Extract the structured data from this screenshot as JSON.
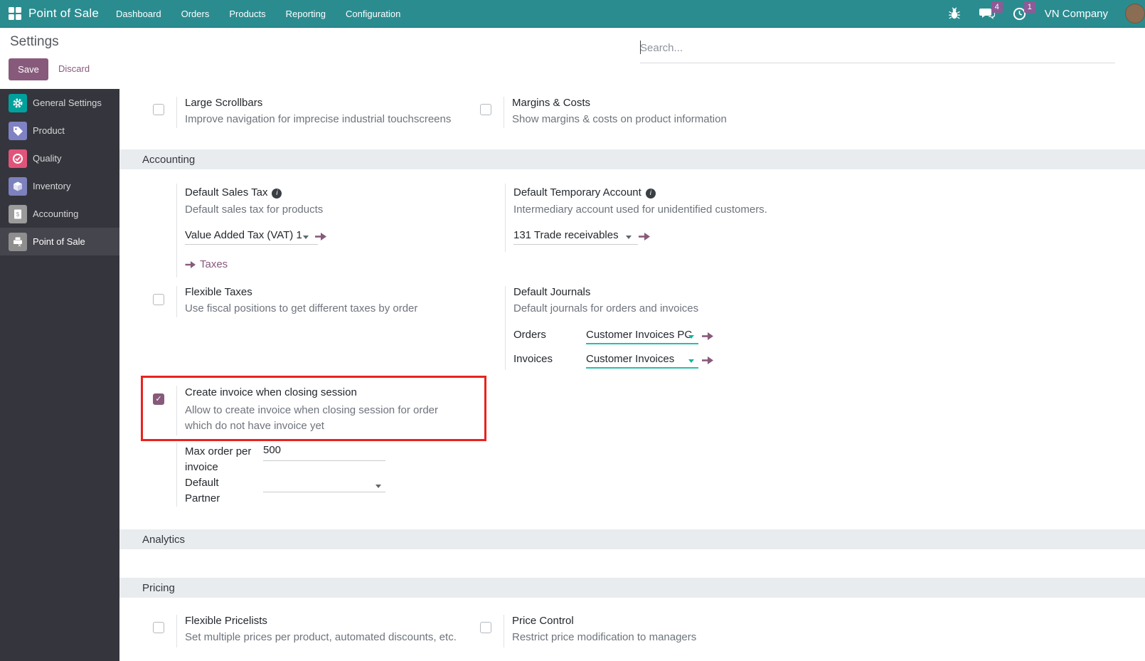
{
  "icons": {
    "check": "✓",
    "info": "i"
  },
  "colors": {
    "navbar": "#2b8c90",
    "accent": "#875A7B",
    "badge": "#8d5b97",
    "teal_underline": "#25bfae",
    "highlight_red": "#e8231d",
    "section_header_bg": "#e9ecef",
    "sidebar_bg": "#35353d"
  },
  "navbar": {
    "app_title": "Point of Sale",
    "menu": [
      {
        "label": "Dashboard"
      },
      {
        "label": "Orders"
      },
      {
        "label": "Products"
      },
      {
        "label": "Reporting"
      },
      {
        "label": "Configuration"
      }
    ],
    "message_count": "4",
    "activity_count": "1",
    "company": "VN Company"
  },
  "control_panel": {
    "title": "Settings",
    "save": "Save",
    "discard": "Discard",
    "search_placeholder": "Search..."
  },
  "sidebar": {
    "items": [
      {
        "label": "General Settings",
        "icon": "gear-icon",
        "color": "#00a09d",
        "active": false
      },
      {
        "label": "Product",
        "icon": "tag-icon",
        "color": "#7f82c3",
        "active": false
      },
      {
        "label": "Quality",
        "icon": "quality-check-icon",
        "color": "#e1547a",
        "active": false
      },
      {
        "label": "Inventory",
        "icon": "box-icon",
        "color": "#7d81bd",
        "active": false
      },
      {
        "label": "Accounting",
        "icon": "invoice-icon",
        "color": "#9b9b9b",
        "active": false
      },
      {
        "label": "Point of Sale",
        "icon": "cash-register-icon",
        "color": "#8e8e8e",
        "active": true
      }
    ]
  },
  "interface": {
    "large_scrollbars": {
      "title": "Large Scrollbars",
      "description": "Improve navigation for imprecise industrial touchscreens",
      "checked": false
    },
    "margins_costs": {
      "title": "Margins & Costs",
      "description": "Show margins & costs on product information",
      "checked": false
    }
  },
  "accounting": {
    "header": "Accounting",
    "default_sales_tax": {
      "title": "Default Sales Tax",
      "description": "Default sales tax for products",
      "value": "Value Added Tax (VAT) 1",
      "link": "Taxes"
    },
    "default_temporary_account": {
      "title": "Default Temporary Account",
      "description": "Intermediary account used for unidentified customers.",
      "value": "131 Trade receivables"
    },
    "flexible_taxes": {
      "title": "Flexible Taxes",
      "description": "Use fiscal positions to get different taxes by order",
      "checked": false
    },
    "default_journals": {
      "title": "Default Journals",
      "description": "Default journals for orders and invoices",
      "orders_label": "Orders",
      "orders_value": "Customer Invoices PC",
      "invoices_label": "Invoices",
      "invoices_value": "Customer Invoices"
    },
    "create_invoice": {
      "title": "Create invoice when closing session",
      "description": "Allow to create invoice when closing session for order which do not have invoice yet",
      "checked": true,
      "highlighted": true
    },
    "max_order": {
      "label": "Max order per invoice",
      "value": "500"
    },
    "default_partner": {
      "label": "Default Partner",
      "value": ""
    }
  },
  "analytics": {
    "header": "Analytics"
  },
  "pricing": {
    "header": "Pricing",
    "flexible_pricelists": {
      "title": "Flexible Pricelists",
      "description": "Set multiple prices per product, automated discounts, etc.",
      "checked": false
    },
    "price_control": {
      "title": "Price Control",
      "description": "Restrict price modification to managers",
      "checked": false
    }
  }
}
